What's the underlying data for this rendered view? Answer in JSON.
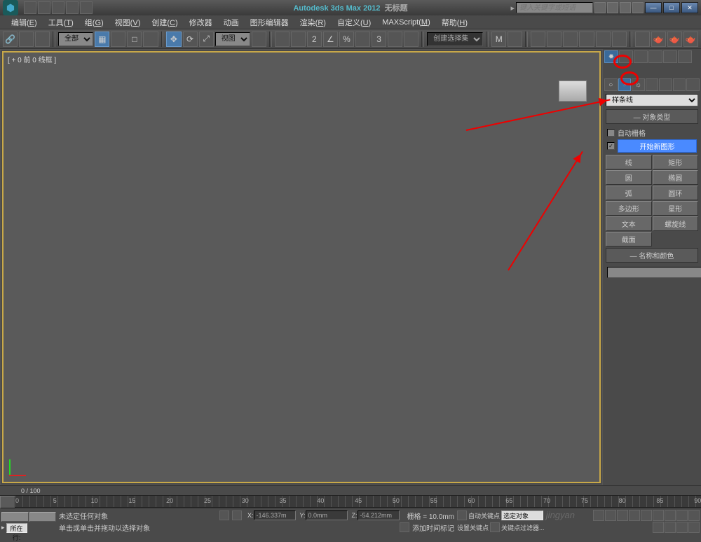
{
  "title": {
    "app": "Autodesk 3ds Max 2012",
    "doc": "无标题"
  },
  "search": {
    "placeholder": "键入关键字或短语"
  },
  "menu": [
    {
      "l": "编辑",
      "k": "E"
    },
    {
      "l": "工具",
      "k": "T"
    },
    {
      "l": "组",
      "k": "G"
    },
    {
      "l": "视图",
      "k": "V"
    },
    {
      "l": "创建",
      "k": "C"
    },
    {
      "l": "修改器",
      "k": ""
    },
    {
      "l": "动画",
      "k": ""
    },
    {
      "l": "图形编辑器",
      "k": ""
    },
    {
      "l": "渲染",
      "k": "R"
    },
    {
      "l": "自定义",
      "k": "U"
    },
    {
      "l": "MAXScript",
      "k": "M"
    },
    {
      "l": "帮助",
      "k": "H"
    }
  ],
  "toolbar": {
    "filter_dd": "全部",
    "view_dd": "视图",
    "sel_dd": "创建选择集"
  },
  "viewport": {
    "label": "[ + 0 前 0 线框 ]"
  },
  "cmdpanel": {
    "category": "样条线",
    "rollout1": "对象类型",
    "auto_grid": "自动栅格",
    "start_shape": "开始新图形",
    "objects": [
      [
        "线",
        "矩形"
      ],
      [
        "圆",
        "椭圆"
      ],
      [
        "弧",
        "圆环"
      ],
      [
        "多边形",
        "星形"
      ],
      [
        "文本",
        "螺旋线"
      ]
    ],
    "section": "截面",
    "rollout2": "名称和颜色"
  },
  "timeline": {
    "range": "0 / 100",
    "ticks": [
      0,
      5,
      10,
      15,
      20,
      25,
      30,
      35,
      40,
      45,
      50,
      55,
      60,
      65,
      70,
      75,
      80,
      85,
      90
    ]
  },
  "status": {
    "msg1": "未选定任何对象",
    "msg2": "单击或单击并拖动以选择对象",
    "pos_label": "所在行:",
    "coords": {
      "x": "-146.337m",
      "y": "0.0mm",
      "z": "-54.212mm"
    },
    "grid": "栅格 = 10.0mm",
    "add_marker": "添加时间标记",
    "autokey": "自动关键点",
    "sel_obj": "选定对象",
    "setkey": "设置关键点",
    "keyfilter": "关键点过滤器..."
  }
}
